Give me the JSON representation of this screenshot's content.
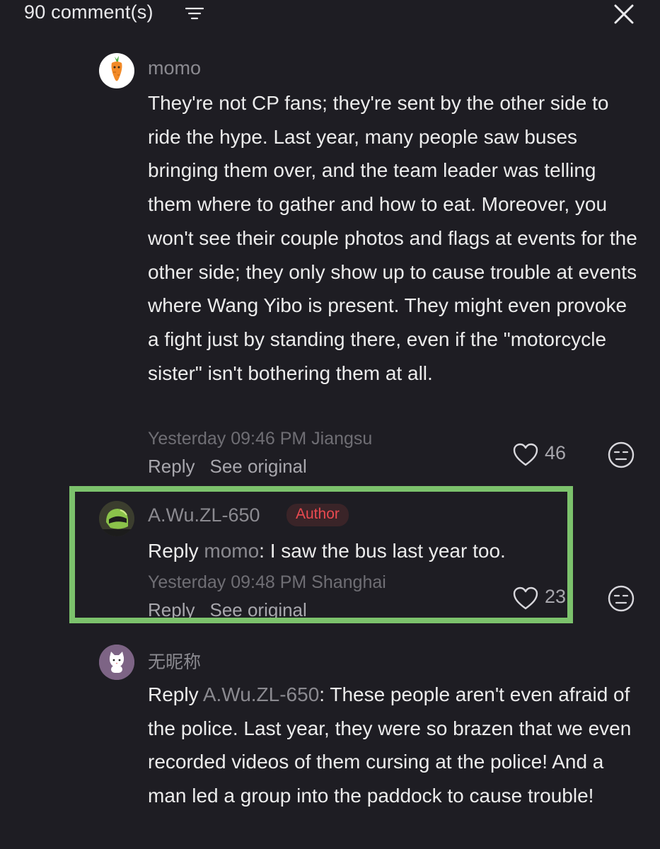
{
  "header": {
    "title": "90 comment(s)",
    "filter_icon": "filter-icon",
    "close_icon": "close-icon"
  },
  "comments": [
    {
      "username": "momo",
      "avatar_icon": "carrot-avatar",
      "text": "They're not CP fans; they're sent by the other side to ride the hype. Last year, many people saw buses bringing them over, and the team leader was telling them where to gather and how to eat. Moreover, you won't see their couple photos and flags at events for the other side; they only show up to cause trouble at events where Wang Yibo is present. They might even provoke a fight just by standing there, even if the \"motorcycle sister\" isn't bothering them at all.",
      "meta": "Yesterday 09:46 PM Jiangsu",
      "reply_label": "Reply",
      "see_original_label": "See original",
      "likes": "46"
    },
    {
      "username": "A.Wu.ZL-650",
      "badge": "Author",
      "avatar_icon": "helmet-avatar",
      "reply_prefix": "Reply",
      "reply_to": "momo",
      "text": ": I saw the bus last year too.",
      "meta": "Yesterday 09:48 PM Shanghai",
      "reply_label": "Reply",
      "see_original_label": "See original",
      "likes": "23"
    },
    {
      "username": "无昵称",
      "avatar_icon": "cat-avatar",
      "reply_prefix": "Reply",
      "reply_to": "A.Wu.ZL-650",
      "text": ": These people aren't even afraid of the police. Last year, they were so brazen that we even recorded videos of them cursing at the police! And a man led a group into the paddock to cause trouble!"
    }
  ],
  "colors": {
    "background": "#1e1d23",
    "text": "#ececec",
    "muted": "#8b8a90",
    "author_badge": "#e94a50",
    "highlight_box": "#7cc26c"
  }
}
